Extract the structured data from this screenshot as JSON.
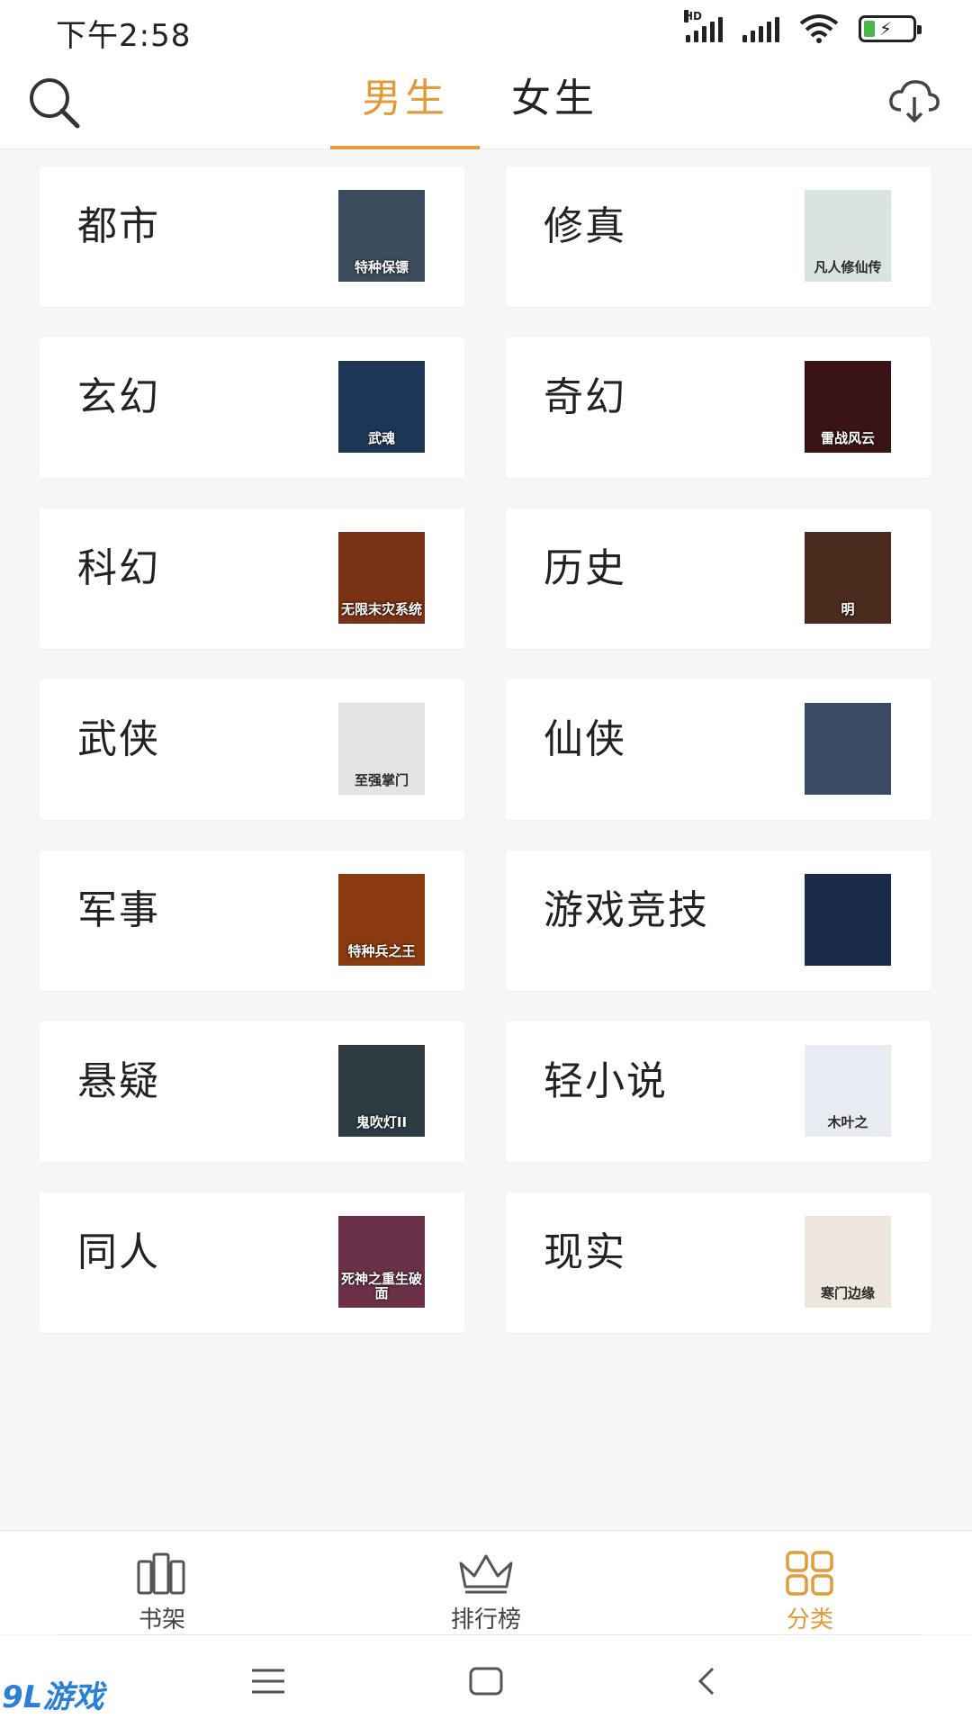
{
  "status_bar": {
    "time": "下午2:58",
    "hd_label": "HD"
  },
  "header": {
    "tabs": [
      {
        "label": "男生",
        "active": true
      },
      {
        "label": "女生",
        "active": false
      }
    ]
  },
  "categories": [
    {
      "label": "都市",
      "cover_title": "特种保镖",
      "cover_color": "#3b4c5c"
    },
    {
      "label": "修真",
      "cover_title": "凡人修仙传",
      "cover_color": "#d9e3df"
    },
    {
      "label": "玄幻",
      "cover_title": "武魂",
      "cover_color": "#1d3658"
    },
    {
      "label": "奇幻",
      "cover_title": "雷战风云",
      "cover_color": "#3a1414"
    },
    {
      "label": "科幻",
      "cover_title": "无限末灾系统",
      "cover_color": "#7a3216"
    },
    {
      "label": "历史",
      "cover_title": "明",
      "cover_color": "#4a2a1c"
    },
    {
      "label": "武侠",
      "cover_title": "至强掌门",
      "cover_color": "#e4e4e4"
    },
    {
      "label": "仙侠",
      "cover_title": "",
      "cover_color": "#3a4a62"
    },
    {
      "label": "军事",
      "cover_title": "特种兵之王",
      "cover_color": "#8a3a0e"
    },
    {
      "label": "游戏竞技",
      "cover_title": "",
      "cover_color": "#1a2a4a"
    },
    {
      "label": "悬疑",
      "cover_title": "鬼吹灯II",
      "cover_color": "#2e3b42"
    },
    {
      "label": "轻小说",
      "cover_title": "木叶之",
      "cover_color": "#e8ecf2"
    },
    {
      "label": "同人",
      "cover_title": "死神之重生破面",
      "cover_color": "#6a3048"
    },
    {
      "label": "现实",
      "cover_title": "寒门边缘",
      "cover_color": "#ece6dc"
    }
  ],
  "bottom_nav": [
    {
      "label": "书架",
      "icon": "bookshelf-icon",
      "active": false
    },
    {
      "label": "排行榜",
      "icon": "crown-icon",
      "active": false
    },
    {
      "label": "分类",
      "icon": "grid-icon",
      "active": true
    }
  ],
  "watermark": {
    "text": "9L游戏"
  },
  "colors": {
    "accent": "#e39a38",
    "background": "#f6f6f6",
    "card": "#ffffff",
    "text": "#222222"
  }
}
